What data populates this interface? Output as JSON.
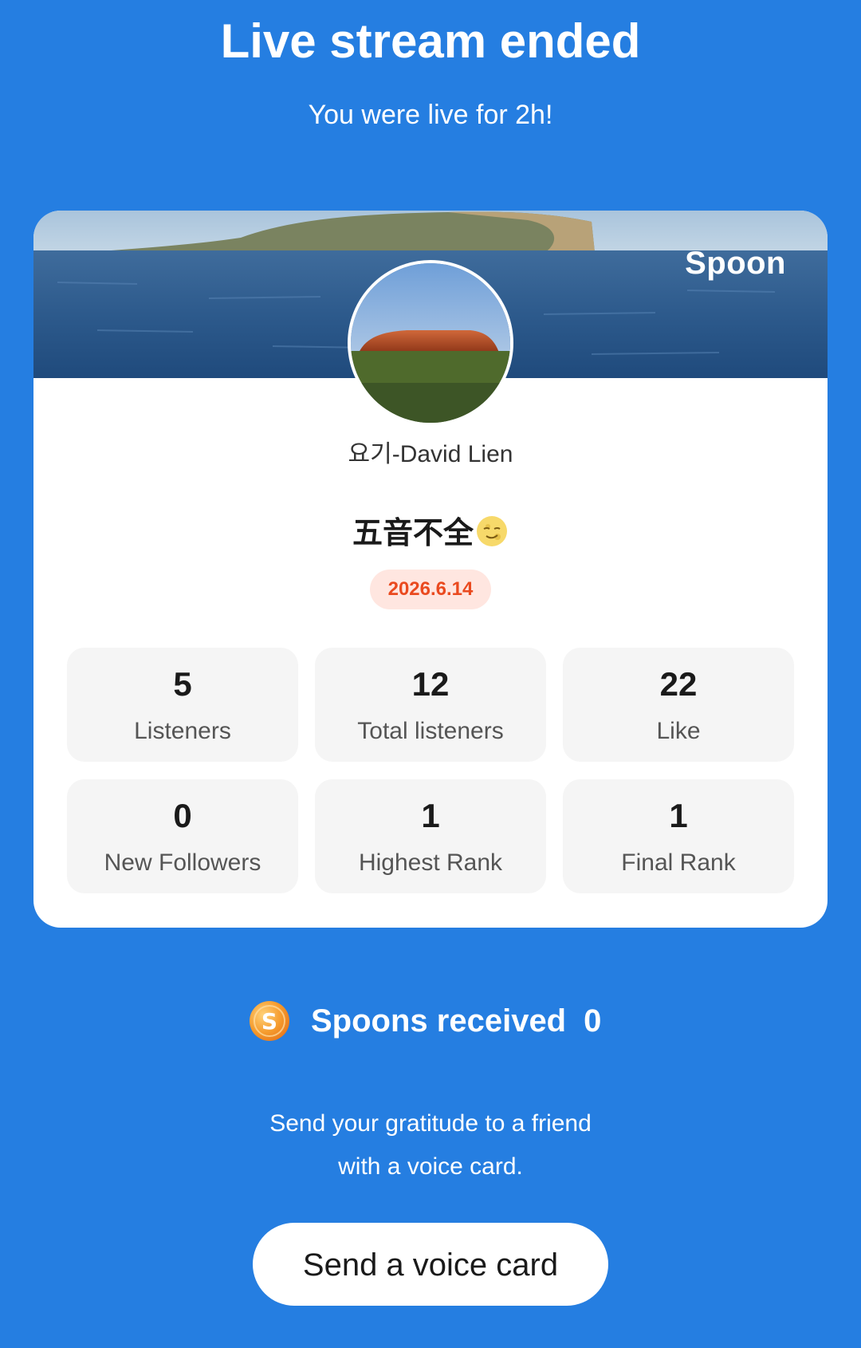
{
  "header": {
    "title": "Live stream ended",
    "subtitle": "You were live for 2h!"
  },
  "card": {
    "brand": "Spoon",
    "host_name": "요기-David Lien",
    "stream_title": "五音不全",
    "stream_title_emoji": "smirking-moon-face-icon",
    "date": "2026.6.14",
    "stats": [
      {
        "value": "5",
        "label": "Listeners"
      },
      {
        "value": "12",
        "label": "Total listeners"
      },
      {
        "value": "22",
        "label": "Like"
      },
      {
        "value": "0",
        "label": "New Followers"
      },
      {
        "value": "1",
        "label": "Highest Rank"
      },
      {
        "value": "1",
        "label": "Final Rank"
      }
    ]
  },
  "spoons": {
    "icon": "spoon-coin-icon",
    "label": "Spoons received",
    "count": "0"
  },
  "gratitude": {
    "line1": "Send your gratitude to a friend",
    "line2": "with a voice card."
  },
  "cta": {
    "label": "Send a voice card"
  },
  "colors": {
    "background": "#257ee1",
    "date_text": "#ea4a1f",
    "date_bg": "#ffe6e0",
    "stat_bg": "#f5f5f5",
    "coin": "#f59a2c"
  }
}
